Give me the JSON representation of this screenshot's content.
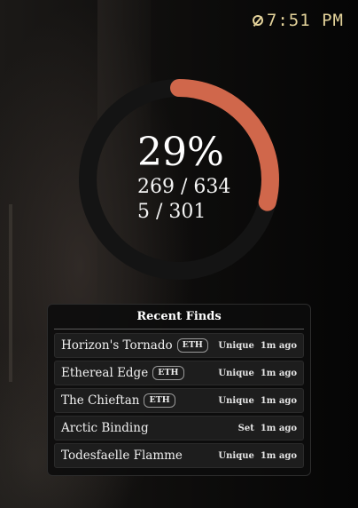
{
  "clock": {
    "time": "7:51 PM",
    "icon": "clock-icon"
  },
  "progress": {
    "percent_label": "29%",
    "fraction": 0.29,
    "collected_line": "269 / 634",
    "secondary_line": "5 / 301",
    "ring_color": "#d0674b",
    "track_color": "#141414"
  },
  "recent": {
    "title": "Recent Finds",
    "items": [
      {
        "name": "Horizon's Tornado",
        "badge": "ETH",
        "rarity": "Unique",
        "time": "1m ago"
      },
      {
        "name": "Ethereal Edge",
        "badge": "ETH",
        "rarity": "Unique",
        "time": "1m ago"
      },
      {
        "name": "The Chieftan",
        "badge": "ETH",
        "rarity": "Unique",
        "time": "1m ago"
      },
      {
        "name": "Arctic Binding",
        "badge": "",
        "rarity": "Set",
        "time": "1m ago"
      },
      {
        "name": "Todesfaelle Flamme",
        "badge": "",
        "rarity": "Unique",
        "time": "1m ago"
      }
    ]
  }
}
